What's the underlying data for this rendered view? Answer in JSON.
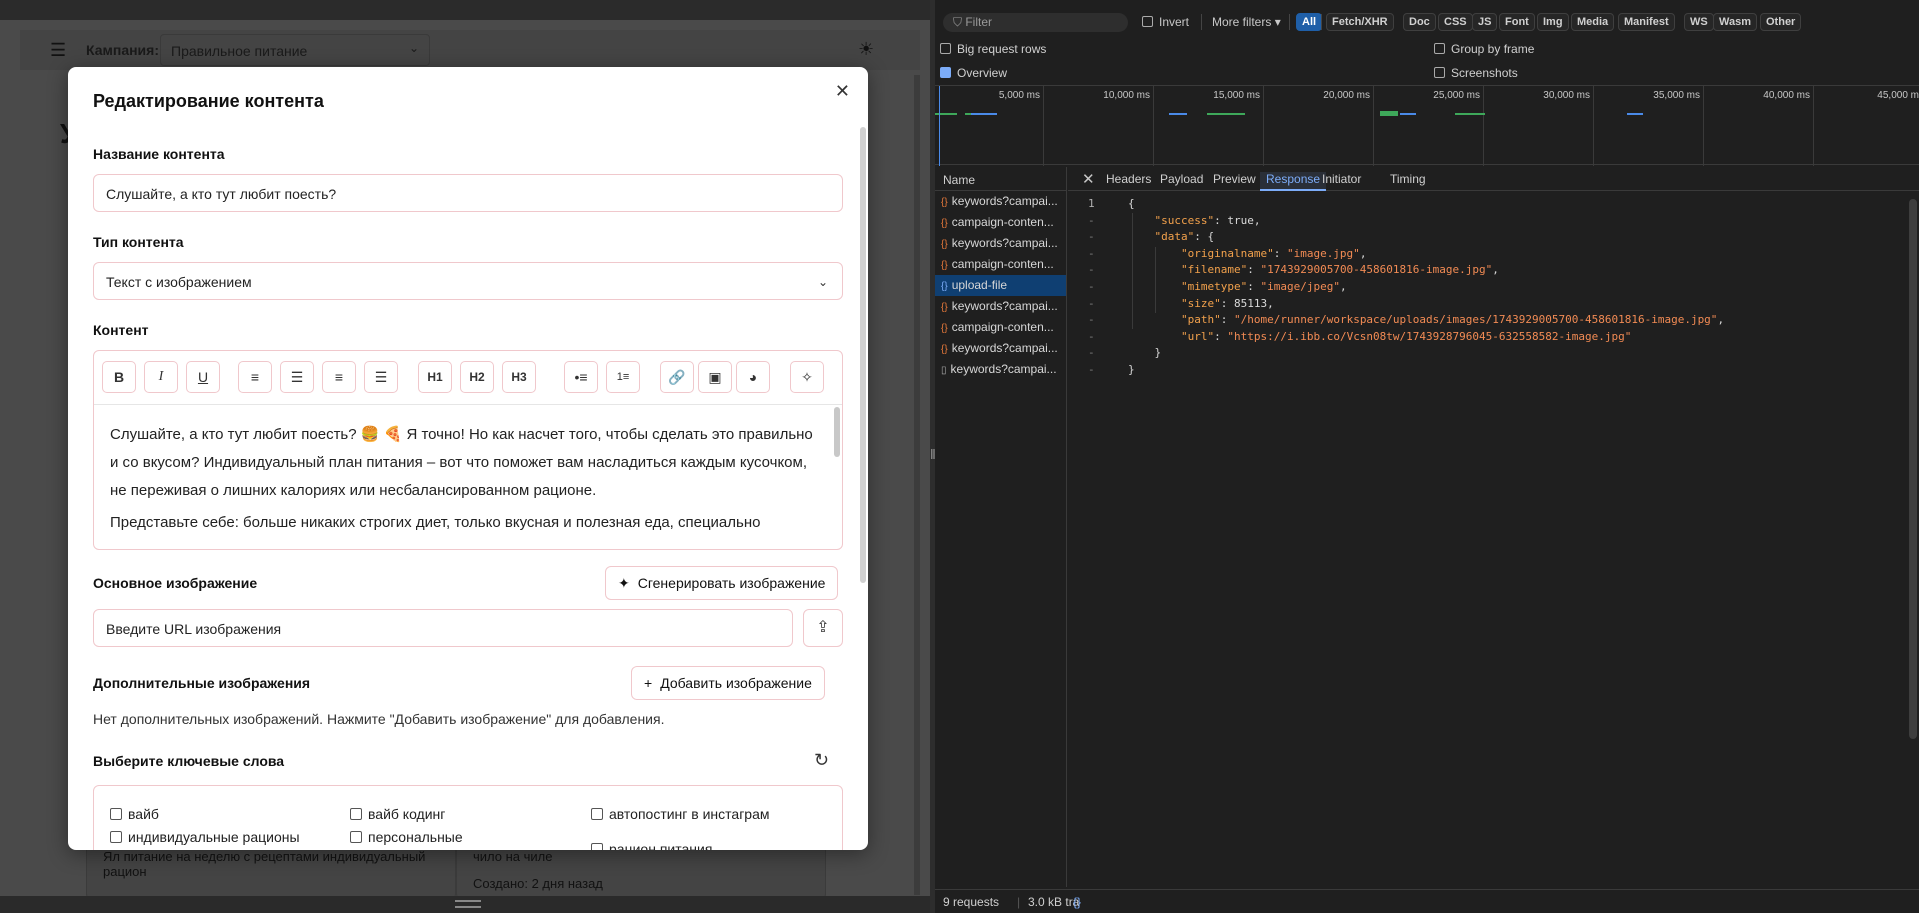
{
  "app": {
    "campaign_label": "Кампания:",
    "campaign_value": "Правильное питание",
    "bg_title": "У",
    "bg_card1_text": "Ял питание на неделю с рецептами индивидуальный рацион",
    "bg_card2_text": "чило на чиле",
    "bg_card2_created": "Создано: 2 дня назад"
  },
  "modal": {
    "title": "Редактирование контента",
    "name_label": "Название контента",
    "name_value": "Слушайте, а кто тут любит поесть?",
    "type_label": "Тип контента",
    "type_value": "Текст с изображением",
    "content_label": "Контент",
    "toolbar": [
      "B",
      "I",
      "U",
      "align-left",
      "align-center",
      "align-right",
      "justify",
      "H1",
      "H2",
      "H3",
      "bullet-list",
      "ordered-list",
      "link",
      "image",
      "palette",
      "magic"
    ],
    "content_p1": "Слушайте, а кто тут любит поесть? 🍔 🍕 Я точно! Но как насчет того, чтобы сделать это правильно и со вкусом? Индивидуальный план питания – вот что поможет вам насладиться каждым кусочком, не переживая о лишних калориях или несбалансированном рационе.",
    "content_p2": "Представьте себе: больше никаких строгих диет, только вкусная и полезная еда, специально",
    "main_image_label": "Основное изображение",
    "generate_image_label": "Сгенерировать изображение",
    "image_url_placeholder": "Введите URL изображения",
    "additional_images_label": "Дополнительные изображения",
    "add_image_label": "Добавить изображение",
    "no_images_note": "Нет дополнительных изображений. Нажмите \"Добавить изображение\" для добавления.",
    "keywords_label": "Выберите ключевые слова",
    "keywords": [
      "вайб",
      "вайб кодинг",
      "автопостинг в инстаграм",
      "индивидуальные рационы",
      "персональные",
      "рацион питания"
    ]
  },
  "devtools": {
    "filter_placeholder": "Filter",
    "invert_label": "Invert",
    "more_filters_label": "More filters",
    "type_chips": [
      "All",
      "Fetch/XHR",
      "Doc",
      "CSS",
      "JS",
      "Font",
      "Img",
      "Media",
      "Manifest",
      "WS",
      "Wasm",
      "Other"
    ],
    "active_chip": "All",
    "options": {
      "big_request_rows": "Big request rows",
      "overview": "Overview",
      "group_by_frame": "Group by frame",
      "screenshots": "Screenshots"
    },
    "timeline_ticks": [
      "5,000 ms",
      "10,000 ms",
      "15,000 ms",
      "20,000 ms",
      "25,000 ms",
      "30,000 ms",
      "35,000 ms",
      "40,000 ms",
      "45,000 m"
    ],
    "name_header": "Name",
    "requests": [
      "keywords?campai...",
      "campaign-conten...",
      "keywords?campai...",
      "campaign-conten...",
      "upload-file",
      "keywords?campai...",
      "campaign-conten...",
      "keywords?campai...",
      "keywords?campai..."
    ],
    "selected_request": "upload-file",
    "tabs": [
      "Headers",
      "Payload",
      "Preview",
      "Response",
      "Initiator",
      "Timing"
    ],
    "active_tab": "Response",
    "response": {
      "success": "true",
      "originalname": "\"image.jpg\"",
      "filename": "\"1743929005700-458601816-image.jpg\"",
      "mimetype": "\"image/jpeg\"",
      "size": "85113",
      "path": "\"/home/runner/workspace/uploads/images/1743929005700-458601816-image.jpg\"",
      "url": "\"https://i.ibb.co/Vcsn08tw/1743928796045-632558582-image.jpg\""
    },
    "status_requests": "9 requests",
    "status_transferred": "3.0 kB tra",
    "colors": {
      "accent": "#7cacf8",
      "selected_row": "#0f3f72",
      "json_key": "#f2a14c",
      "json_string": "#f28b54"
    }
  }
}
